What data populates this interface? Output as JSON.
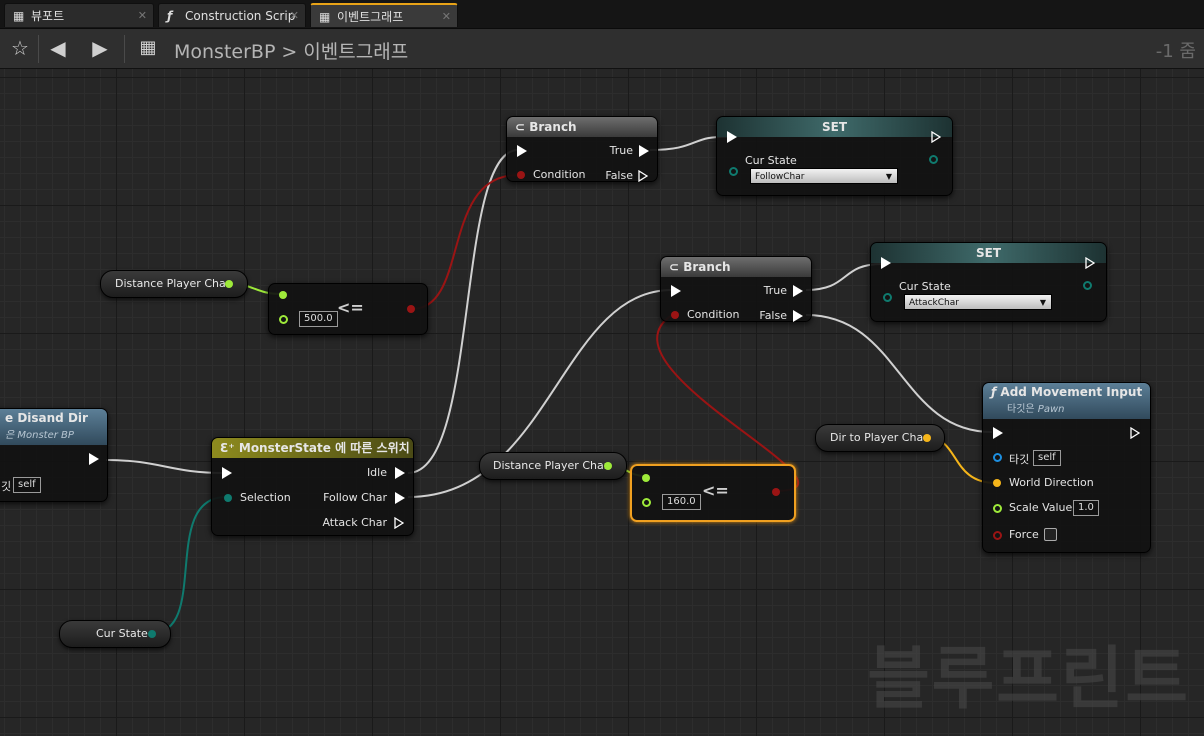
{
  "tabs": [
    {
      "icon": "viewport-icon",
      "glyph": "▦",
      "label": "뷰포트"
    },
    {
      "icon": "function-icon",
      "glyph": "ƒ",
      "label": "Construction Scrip"
    },
    {
      "icon": "event-graph-icon",
      "glyph": "▦",
      "label": "이벤트그래프"
    }
  ],
  "toolbar": {
    "breadcrumb_root": "MonsterBP",
    "breadcrumb_sep": ">",
    "breadcrumb_current": "이벤트그래프",
    "zoom": "-1 줌"
  },
  "nodes": {
    "branch1": {
      "title": "Branch",
      "true_label": "True",
      "false_label": "False",
      "condition_label": "Condition"
    },
    "branch2": {
      "title": "Branch",
      "true_label": "True",
      "false_label": "False",
      "condition_label": "Condition"
    },
    "set1": {
      "title": "SET",
      "var_label": "Cur State",
      "value": "FollowChar"
    },
    "set2": {
      "title": "SET",
      "var_label": "Cur State",
      "value": "AttackChar"
    },
    "cmp1": {
      "value": "500.0",
      "op": "<="
    },
    "cmp2": {
      "value": "160.0",
      "op": "<="
    },
    "get_dist1": {
      "label": "Distance Player Char"
    },
    "get_dist2": {
      "label": "Distance Player Char"
    },
    "get_dir": {
      "label": "Dir to Player Char"
    },
    "get_state": {
      "label": "Cur State"
    },
    "switch": {
      "title": "MonsterState 에 따른 스위치",
      "selection_label": "Selection",
      "out_idle": "Idle",
      "out_follow": "Follow Char",
      "out_attack": "Attack Char"
    },
    "left_func": {
      "title": "e Disand Dir",
      "subtitle": "은 Monster BP",
      "target_prefix": "깃",
      "target_value": "self"
    },
    "add_movement": {
      "title": "Add Movement Input",
      "subtitle_prefix": "타깃은",
      "subtitle_class": "Pawn",
      "target_label": "타깃",
      "target_value": "self",
      "world_direction_label": "World Direction",
      "scale_value_label": "Scale Value",
      "scale_value": "1.0",
      "force_label": "Force"
    }
  },
  "watermark": "블루프린트",
  "colors": {
    "exec": "#ffffff",
    "bool": "#8b0f0f",
    "float": "#9eea3a",
    "vector": "#f5b51a",
    "enum": "#0f7a6e",
    "object": "#1d8fe0"
  }
}
